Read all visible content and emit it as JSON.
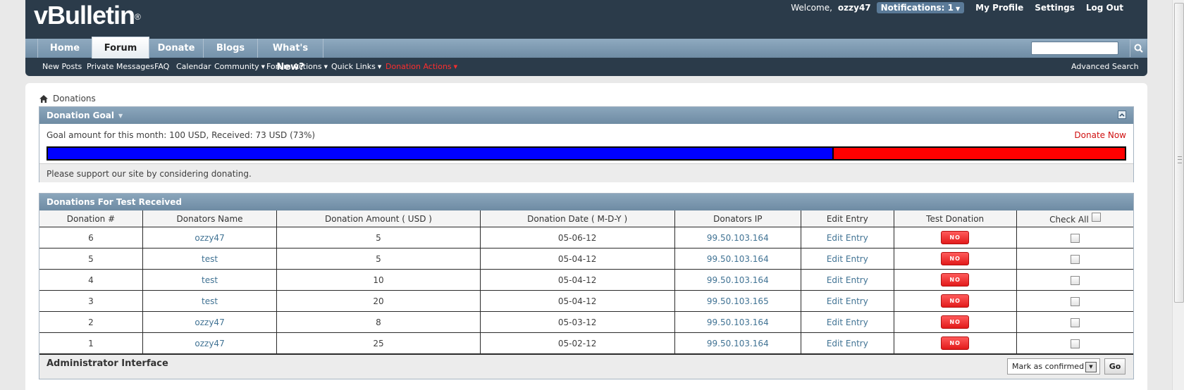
{
  "header": {
    "logo": "vBulletin",
    "logo_mark": "®",
    "welcome": "Welcome,",
    "username": "ozzy47",
    "notifications": "Notifications: 1",
    "links": [
      "My Profile",
      "Settings",
      "Log Out"
    ]
  },
  "nav": {
    "tabs": [
      "Home",
      "Forum",
      "Donate",
      "Blogs",
      "What's New?"
    ],
    "active_tab": "Forum",
    "search_placeholder": "",
    "subnav": [
      "New Posts",
      "Private Messages",
      "FAQ",
      "Calendar",
      "Community",
      "Forum Actions",
      "Quick Links",
      "Donation Actions"
    ],
    "advanced_search": "Advanced Search"
  },
  "breadcrumb": "Donations",
  "goal": {
    "title": "Donation Goal",
    "text": "Goal amount for this month: 100 USD, Received: 73 USD (73%)",
    "donate_now": "Donate Now",
    "progress_fraction": 0.73,
    "footer": "Please support our site by considering donating.",
    "bar_fill_color": "#0000ff",
    "bar_rest_color": "#ff0000"
  },
  "donations": {
    "title": "Donations For Test Received",
    "columns": [
      "Donation #",
      "Donators Name",
      "Donation Amount ( USD )",
      "Donation Date ( M-D-Y )",
      "Donators IP",
      "Edit Entry",
      "Test Donation",
      "Check All"
    ],
    "rows": [
      {
        "num": "6",
        "name": "ozzy47",
        "amount": "5",
        "date": "05-06-12",
        "ip": "99.50.103.164",
        "edit": "Edit Entry",
        "test": "NO"
      },
      {
        "num": "5",
        "name": "test",
        "amount": "5",
        "date": "05-04-12",
        "ip": "99.50.103.164",
        "edit": "Edit Entry",
        "test": "NO"
      },
      {
        "num": "4",
        "name": "test",
        "amount": "10",
        "date": "05-04-12",
        "ip": "99.50.103.164",
        "edit": "Edit Entry",
        "test": "NO"
      },
      {
        "num": "3",
        "name": "test",
        "amount": "20",
        "date": "05-04-12",
        "ip": "99.50.103.165",
        "edit": "Edit Entry",
        "test": "NO"
      },
      {
        "num": "2",
        "name": "ozzy47",
        "amount": "8",
        "date": "05-03-12",
        "ip": "99.50.103.164",
        "edit": "Edit Entry",
        "test": "NO"
      },
      {
        "num": "1",
        "name": "ozzy47",
        "amount": "25",
        "date": "05-02-12",
        "ip": "99.50.103.164",
        "edit": "Edit Entry",
        "test": "NO"
      }
    ],
    "admin_title": "Administrator Interface",
    "action_select": "Mark as confirmed",
    "go_button": "Go"
  }
}
